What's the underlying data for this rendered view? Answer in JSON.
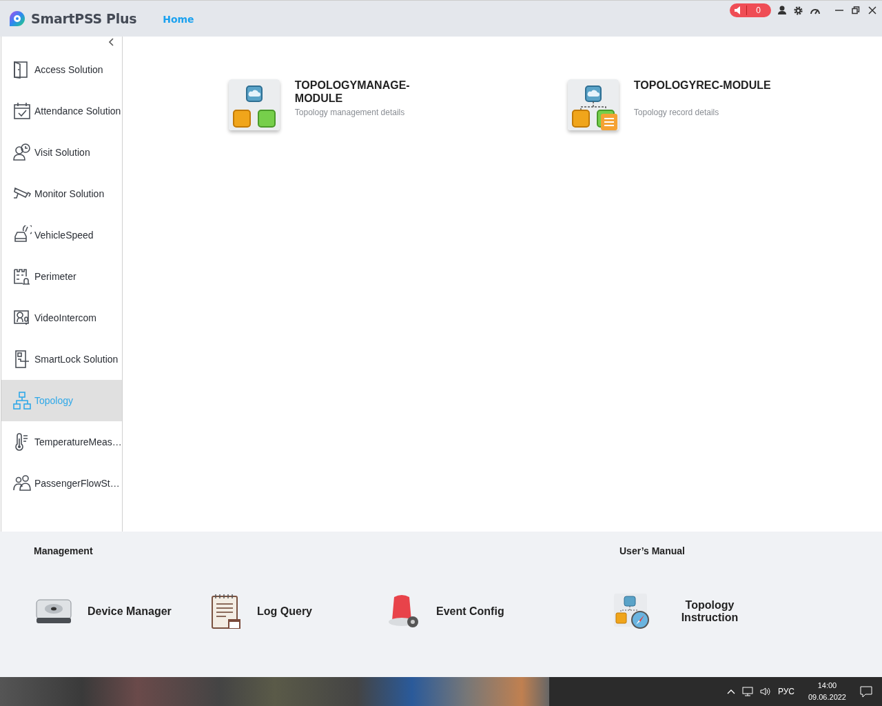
{
  "app": {
    "title": "SmartPSS Plus",
    "nav": "Home",
    "alarm_count": "0"
  },
  "sidebar": {
    "items": [
      {
        "label": "Access Solution",
        "selected": false
      },
      {
        "label": "Attendance Solution",
        "selected": false
      },
      {
        "label": "Visit Solution",
        "selected": false
      },
      {
        "label": "Monitor Solution",
        "selected": false
      },
      {
        "label": "VehicleSpeed",
        "selected": false
      },
      {
        "label": "Perimeter",
        "selected": false
      },
      {
        "label": "VideoIntercom",
        "selected": false
      },
      {
        "label": "SmartLock Solution",
        "selected": false
      },
      {
        "label": "Topology",
        "selected": true
      },
      {
        "label": "TemperatureMeas…",
        "selected": false
      },
      {
        "label": "PassengerFlowSt…",
        "selected": false
      }
    ]
  },
  "modules": [
    {
      "kind": "manage",
      "title": "TOPOLOGYMANAGE-MODULE",
      "description": "Topology management details"
    },
    {
      "kind": "record",
      "title": "TOPOLOGYREC-MODULE",
      "description": "Topology record details"
    }
  ],
  "management": {
    "heading": "Management",
    "tools": [
      {
        "kind": "device",
        "label": "Device Manager"
      },
      {
        "kind": "log",
        "label": "Log Query"
      },
      {
        "kind": "event",
        "label": "Event Config"
      }
    ]
  },
  "manual": {
    "heading": "User’s Manual",
    "tools": [
      {
        "kind": "instruction",
        "label": "Topology Instruction"
      }
    ]
  },
  "taskbar": {
    "language": "РУС",
    "time": "14:00",
    "date": "09.06.2022"
  }
}
